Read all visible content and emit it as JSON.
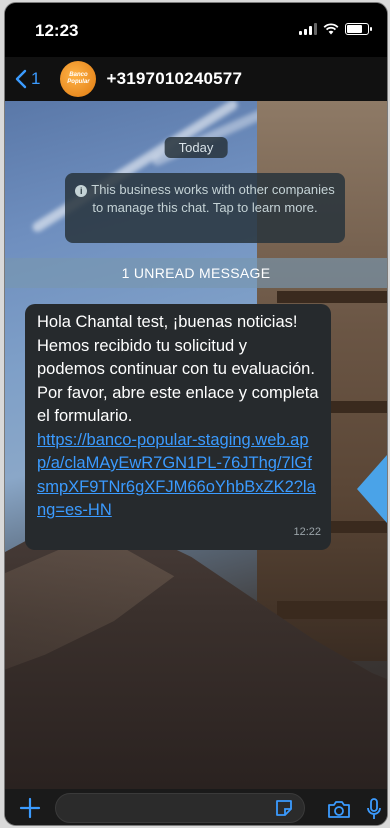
{
  "status_bar": {
    "time": "12:23",
    "battery_level": 0.8
  },
  "header": {
    "back_count": "1",
    "contact_name": "+3197010240577",
    "avatar_text": "Banco Popular"
  },
  "chat": {
    "date_label": "Today",
    "business_notice": "This business works with other companies to manage this chat. Tap to learn more.",
    "unread_banner": "1 UNREAD MESSAGE",
    "message": {
      "text": "Hola Chantal test, ¡buenas noticias! Hemos recibido tu solicitud y podemos continuar con tu evaluación. Por favor, abre este enlace y completa el formulario.",
      "link": "https://banco-popular-staging.web.app/a/claMAyEwR7GN1PL-76JThg/7lGfsmpXF9TNr6gXFJM66oYhbBxZK2?lang=es-HN",
      "time": "12:22"
    }
  },
  "colors": {
    "accent": "#3b9bff",
    "bubble": "#262a2d",
    "annotation_arrow": "#4aa3e8"
  },
  "icons": {
    "back": "chevron-left-icon",
    "plus": "plus-icon",
    "sticker": "sticker-icon",
    "camera": "camera-icon",
    "mic": "microphone-icon"
  }
}
